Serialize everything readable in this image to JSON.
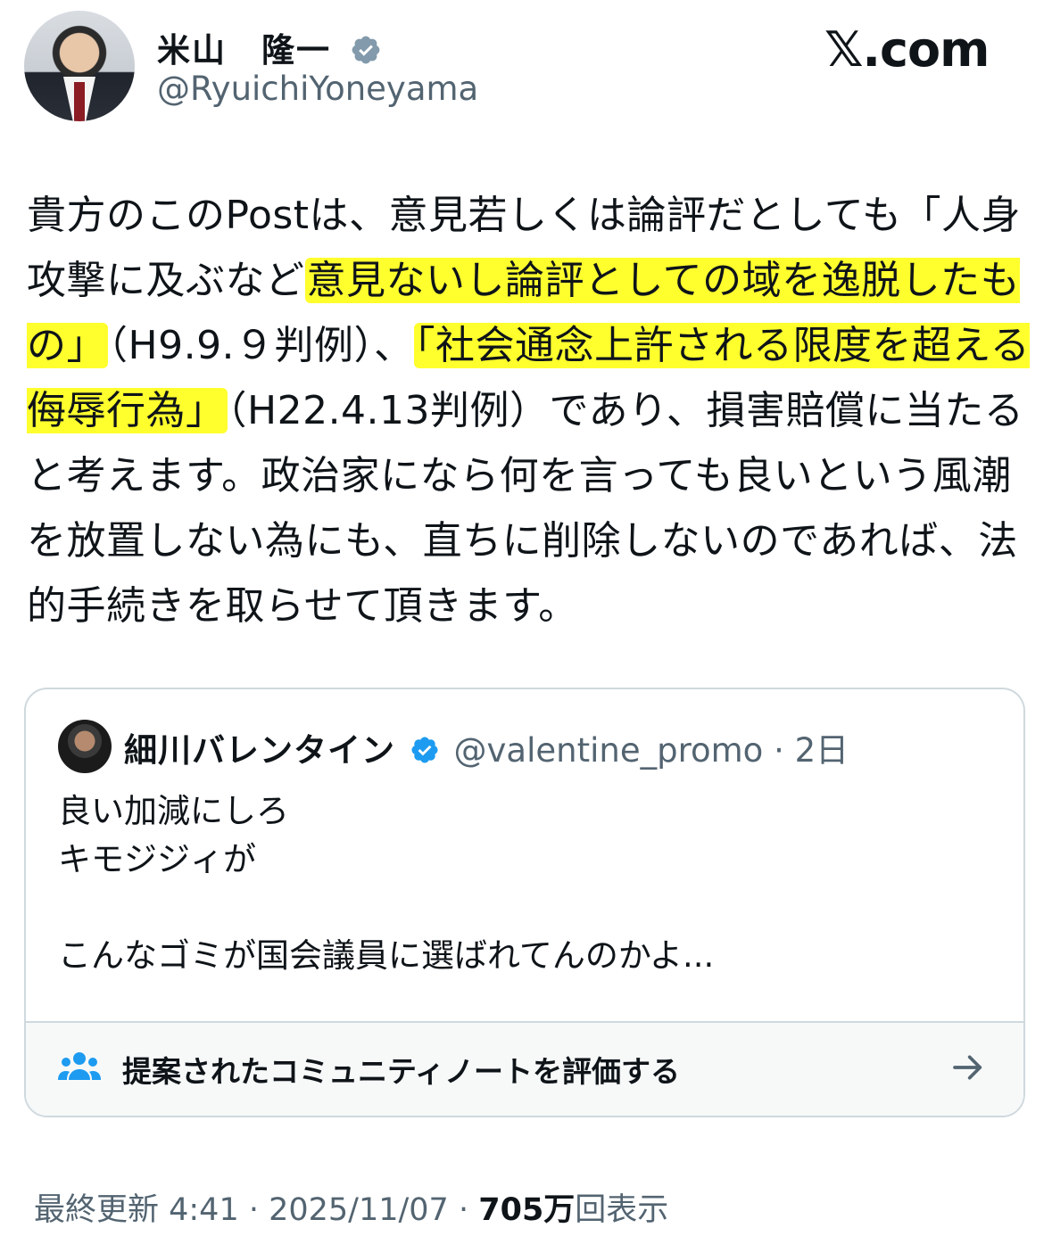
{
  "author": {
    "name": "米山　隆一",
    "handle": "@RyuichiYoneyama",
    "verified": true
  },
  "brand": {
    "label": "𝕏.com"
  },
  "post": {
    "segments": [
      {
        "text": "貴方のこのPostは、意見若しくは論評だとしても「人身攻撃に及ぶなど",
        "highlight": false
      },
      {
        "text": "意見ないし論評としての域を逸脱したもの」",
        "highlight": true
      },
      {
        "text": "（H9.9.９判例）、",
        "highlight": false
      },
      {
        "text": "「社会通念上許される限度を超える侮辱行為」",
        "highlight": true
      },
      {
        "text": "（H22.4.13判例）であり、損害賠償に当たると考えます。政治家になら何を言っても良いという風潮を放置しない為にも、直ちに削除しないのであれば、法的手続きを取らせて頂きます。",
        "highlight": false
      }
    ]
  },
  "quoted": {
    "name": "細川バレンタイン",
    "handle": "@valentine_promo",
    "separator": "·",
    "time": "2日",
    "text": "良い加減にしろ\nキモジジィが\n\nこんなゴミが国会議員に選ばれてんのかよ...",
    "community_note_label": "提案されたコミュニティノートを評価する"
  },
  "meta": {
    "prefix": "最終更新 4:41 · 2025/11/07 ",
    "separator": "·",
    "views_count": "705万",
    "views_label": "回表示"
  },
  "colors": {
    "accent": "#1d9bf0",
    "highlight": "#ffff2e",
    "muted": "#536471"
  },
  "icons": [
    "verified-badge-icon",
    "community-notes-icon",
    "arrow-right-icon"
  ]
}
